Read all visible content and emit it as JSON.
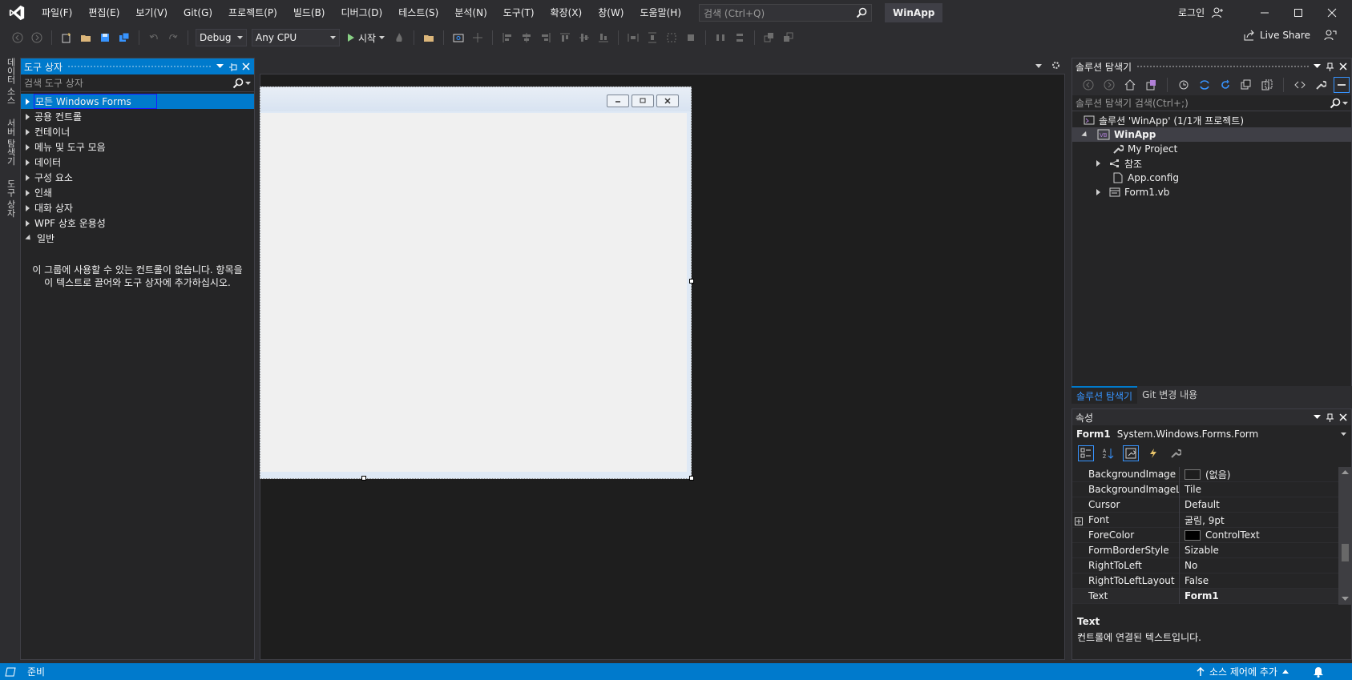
{
  "menu": {
    "items": [
      "파일(F)",
      "편집(E)",
      "보기(V)",
      "Git(G)",
      "프로젝트(P)",
      "빌드(B)",
      "디버그(D)",
      "테스트(S)",
      "분석(N)",
      "도구(T)",
      "확장(X)",
      "창(W)",
      "도움말(H)"
    ],
    "search_placeholder": "검색 (Ctrl+Q)",
    "app_name": "WinApp",
    "login": "로그인"
  },
  "toolbar": {
    "config": "Debug",
    "platform": "Any CPU",
    "start": "시작",
    "live_share": "Live Share"
  },
  "vtabs": [
    "데이터 소스",
    "서버 탐색기",
    "도구 상자"
  ],
  "toolbox": {
    "title": "도구 상자",
    "search_placeholder": "검색 도구 상자",
    "groups": [
      "모든 Windows Forms",
      "공용 컨트롤",
      "컨테이너",
      "메뉴 및 도구 모음",
      "데이터",
      "구성 요소",
      "인쇄",
      "대화 상자",
      "WPF 상호 운용성",
      "일반"
    ],
    "empty_message": "이 그룹에 사용할 수 있는 컨트롤이 없습니다. 항목을 이 텍스트로 끌어와 도구 상자에 추가하십시오."
  },
  "solution_explorer": {
    "title": "솔루션 탐색기",
    "search_placeholder": "솔루션 탐색기 검색(Ctrl+;)",
    "solution": "솔루션 'WinApp' (1/1개 프로젝트)",
    "project": "WinApp",
    "items": [
      "My Project",
      "참조",
      "App.config",
      "Form1.vb"
    ],
    "tabs": [
      "솔루션 탐색기",
      "Git 변경 내용"
    ]
  },
  "properties": {
    "title": "속성",
    "object_name": "Form1",
    "object_type": "System.Windows.Forms.Form",
    "rows": [
      {
        "name": "BackgroundImage",
        "value": "(없음)"
      },
      {
        "name": "BackgroundImageLayout",
        "value": "Tile"
      },
      {
        "name": "Cursor",
        "value": "Default"
      },
      {
        "name": "Font",
        "value": "굴림, 9pt"
      },
      {
        "name": "ForeColor",
        "value": "ControlText"
      },
      {
        "name": "FormBorderStyle",
        "value": "Sizable"
      },
      {
        "name": "RightToLeft",
        "value": "No"
      },
      {
        "name": "RightToLeftLayout",
        "value": "False"
      },
      {
        "name": "Text",
        "value": "Form1"
      }
    ],
    "desc_title": "Text",
    "desc_text": "컨트롤에 연결된 텍스트입니다."
  },
  "status": {
    "ready": "준비",
    "source_control": "소스 제어에 추가"
  },
  "colors": {
    "accent": "#007acc",
    "background": "#2d2d30",
    "panel": "#252526",
    "designer": "#1e1e1e"
  }
}
